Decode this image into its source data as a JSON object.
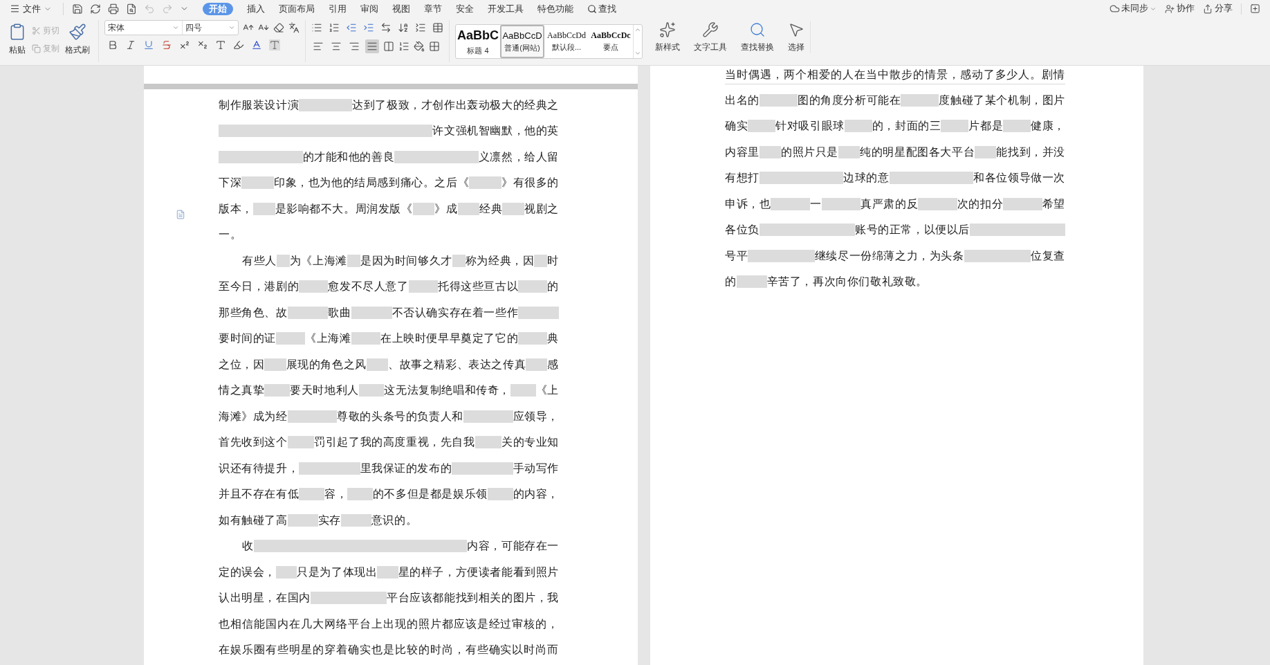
{
  "menu_bar": {
    "file_menu": "文件",
    "tabs": [
      {
        "label": "开始",
        "selected": true
      },
      {
        "label": "插入",
        "selected": false
      },
      {
        "label": "页面布局",
        "selected": false
      },
      {
        "label": "引用",
        "selected": false
      },
      {
        "label": "审阅",
        "selected": false
      },
      {
        "label": "视图",
        "selected": false
      },
      {
        "label": "章节",
        "selected": false
      },
      {
        "label": "安全",
        "selected": false
      },
      {
        "label": "开发工具",
        "selected": false
      },
      {
        "label": "特色功能",
        "selected": false
      }
    ],
    "search": "查找",
    "sync": "未同步",
    "collaborate": "协作",
    "share": "分享"
  },
  "ribbon": {
    "paste": "粘贴",
    "cut": {
      "label": "剪切",
      "disabled": true
    },
    "copy": {
      "label": "复制",
      "disabled": true
    },
    "format_painter": "格式刷",
    "font_family": "宋体",
    "font_size": "四号",
    "align_buttons": [
      {
        "kind": "left",
        "selected": false
      },
      {
        "kind": "center",
        "selected": false
      },
      {
        "kind": "right",
        "selected": false
      },
      {
        "kind": "justify",
        "selected": true
      }
    ],
    "styles": [
      {
        "kind": "heading",
        "preview": "AaBbC",
        "label": "标题 4",
        "selected": false
      },
      {
        "kind": "normal",
        "preview": "AaBbCcD",
        "label": "普通(网站)",
        "selected": true
      },
      {
        "kind": "serif",
        "preview": "AaBbCcDd",
        "label": "默认段...",
        "selected": false
      },
      {
        "kind": "bold_serif",
        "preview": "AaBbCcDc",
        "label": "要点",
        "selected": false
      }
    ],
    "new_style": "新样式",
    "text_tools": "文字工具",
    "find_replace": "查找替换",
    "select": "选择"
  },
  "pages": [
    {
      "lines": [
        {
          "indent": false,
          "last": false,
          "parts": [
            {
              "kind": "text",
              "text": "制作服装设计演"
            },
            {
              "kind": "blur"
            },
            {
              "kind": "text",
              "text": "达到了极致，才创作出轰动极大的经典之"
            }
          ]
        },
        {
          "indent": false,
          "last": false,
          "parts": [
            {
              "kind": "blur"
            },
            {
              "kind": "text",
              "text": "许文强机智幽默，他的英"
            }
          ]
        },
        {
          "indent": false,
          "last": false,
          "parts": [
            {
              "kind": "blur"
            },
            {
              "kind": "text",
              "text": "的才能和他的善良"
            },
            {
              "kind": "blur"
            },
            {
              "kind": "text",
              "text": "义凛然，给人留"
            }
          ]
        },
        {
          "indent": false,
          "last": false,
          "parts": [
            {
              "kind": "text",
              "text": "下深"
            },
            {
              "kind": "blur"
            },
            {
              "kind": "text",
              "text": "印象，也为他的结局感到痛心。之后《"
            },
            {
              "kind": "blur"
            },
            {
              "kind": "text",
              "text": "》有很多的"
            }
          ]
        },
        {
          "indent": false,
          "last": false,
          "parts": [
            {
              "kind": "text",
              "text": "版本，"
            },
            {
              "kind": "blur"
            },
            {
              "kind": "text",
              "text": "是影响都不大。周润发版《"
            },
            {
              "kind": "blur"
            },
            {
              "kind": "text",
              "text": "》成"
            },
            {
              "kind": "blur"
            },
            {
              "kind": "text",
              "text": "经典"
            },
            {
              "kind": "blur"
            },
            {
              "kind": "text",
              "text": "视剧之"
            }
          ]
        },
        {
          "indent": false,
          "last": true,
          "parts": [
            {
              "kind": "text",
              "text": "一。"
            }
          ]
        },
        {
          "indent": true,
          "last": false,
          "parts": [
            {
              "kind": "text",
              "text": "有些人"
            },
            {
              "kind": "blur"
            },
            {
              "kind": "text",
              "text": "为《上海滩"
            },
            {
              "kind": "blur"
            },
            {
              "kind": "text",
              "text": "是因为时间够久才"
            },
            {
              "kind": "blur"
            },
            {
              "kind": "text",
              "text": "称为经典，因"
            },
            {
              "kind": "blur"
            },
            {
              "kind": "text",
              "text": "时"
            }
          ]
        },
        {
          "indent": false,
          "last": false,
          "parts": [
            {
              "kind": "text",
              "text": "至今日，港剧的"
            },
            {
              "kind": "blur"
            },
            {
              "kind": "text",
              "text": "愈发不尽人意了"
            },
            {
              "kind": "blur"
            },
            {
              "kind": "text",
              "text": "托得这些亘古以"
            },
            {
              "kind": "blur"
            },
            {
              "kind": "text",
              "text": "的"
            }
          ]
        },
        {
          "indent": false,
          "last": false,
          "parts": [
            {
              "kind": "text",
              "text": "那些角色、故"
            },
            {
              "kind": "blur"
            },
            {
              "kind": "text",
              "text": "歌曲"
            },
            {
              "kind": "blur"
            },
            {
              "kind": "text",
              "text": "不否认确实存在着一些作"
            },
            {
              "kind": "blur"
            }
          ]
        },
        {
          "indent": false,
          "last": false,
          "parts": [
            {
              "kind": "text",
              "text": "要时间的证"
            },
            {
              "kind": "blur"
            },
            {
              "kind": "text",
              "text": "《上海滩"
            },
            {
              "kind": "blur"
            },
            {
              "kind": "text",
              "text": "在上映时便早早奠定了它的"
            },
            {
              "kind": "blur"
            },
            {
              "kind": "text",
              "text": "典"
            }
          ]
        },
        {
          "indent": false,
          "last": false,
          "parts": [
            {
              "kind": "text",
              "text": "之位，因"
            },
            {
              "kind": "blur"
            },
            {
              "kind": "text",
              "text": "展现的角色之风"
            },
            {
              "kind": "blur"
            },
            {
              "kind": "text",
              "text": "、故事之精彩、表达之传真"
            },
            {
              "kind": "blur"
            },
            {
              "kind": "text",
              "text": "感"
            }
          ]
        },
        {
          "indent": false,
          "last": false,
          "parts": [
            {
              "kind": "text",
              "text": "情之真挚"
            },
            {
              "kind": "blur"
            },
            {
              "kind": "text",
              "text": "要天时地利人"
            },
            {
              "kind": "blur"
            },
            {
              "kind": "text",
              "text": "这无法复制绝唱和传奇，"
            },
            {
              "kind": "blur"
            },
            {
              "kind": "text",
              "text": "《上"
            }
          ]
        },
        {
          "indent": false,
          "last": false,
          "parts": [
            {
              "kind": "text",
              "text": "海滩》成为经"
            },
            {
              "kind": "blur"
            },
            {
              "kind": "text",
              "text": "尊敬的头条号的负责人和"
            },
            {
              "kind": "blur"
            },
            {
              "kind": "text",
              "text": "应领导，"
            }
          ]
        },
        {
          "indent": false,
          "last": false,
          "parts": [
            {
              "kind": "text",
              "text": "首先收到这个"
            },
            {
              "kind": "blur"
            },
            {
              "kind": "text",
              "text": "罚引起了我的高度重视，先自我"
            },
            {
              "kind": "blur"
            },
            {
              "kind": "text",
              "text": "关的专业知"
            }
          ]
        },
        {
          "indent": false,
          "last": false,
          "parts": [
            {
              "kind": "text",
              "text": "识还有待提升，"
            },
            {
              "kind": "blur"
            },
            {
              "kind": "text",
              "text": "里我保证的发布的"
            },
            {
              "kind": "blur"
            },
            {
              "kind": "text",
              "text": "手动写作"
            }
          ]
        },
        {
          "indent": false,
          "last": false,
          "parts": [
            {
              "kind": "text",
              "text": "并且不存在有低"
            },
            {
              "kind": "blur"
            },
            {
              "kind": "text",
              "text": "容，"
            },
            {
              "kind": "blur"
            },
            {
              "kind": "text",
              "text": "的不多但是都是娱乐领"
            },
            {
              "kind": "blur"
            },
            {
              "kind": "text",
              "text": "的内容，"
            }
          ]
        },
        {
          "indent": false,
          "last": true,
          "parts": [
            {
              "kind": "text",
              "text": "如有触碰了高"
            },
            {
              "kind": "blur"
            },
            {
              "kind": "text",
              "text": "实存"
            },
            {
              "kind": "blur"
            },
            {
              "kind": "text",
              "text": "意识的。"
            }
          ]
        },
        {
          "indent": true,
          "last": false,
          "parts": [
            {
              "kind": "text",
              "text": "收"
            },
            {
              "kind": "blur"
            },
            {
              "kind": "text",
              "text": "内容，可能存在一"
            }
          ]
        },
        {
          "indent": false,
          "last": false,
          "parts": [
            {
              "kind": "text",
              "text": "定的误会，"
            },
            {
              "kind": "blur"
            },
            {
              "kind": "text",
              "text": "只是为了体现出"
            },
            {
              "kind": "blur"
            },
            {
              "kind": "text",
              "text": "星的样子，方便读者能看到照片"
            }
          ]
        },
        {
          "indent": false,
          "last": false,
          "parts": [
            {
              "kind": "text",
              "text": "认出明星，在国内"
            },
            {
              "kind": "blur"
            },
            {
              "kind": "text",
              "text": "平台应该都能找到相关的图片，我"
            }
          ]
        },
        {
          "indent": false,
          "last": false,
          "parts": [
            {
              "kind": "text",
              "text": "也相信能国内在几大网络平台上出现的照片都应该是经过审核的，"
            }
          ]
        },
        {
          "indent": false,
          "last": false,
          "parts": [
            {
              "kind": "text",
              "text": "在娱乐圈有些明星的穿着确实也是比较的时尚，有些确实以时尚而"
            }
          ]
        }
      ]
    },
    {
      "top_line": "当时偶遇，两个相爱的人在当中散步的情景，感动了多少人。剧情",
      "lines": [
        {
          "indent": false,
          "last": false,
          "parts": [
            {
              "kind": "text",
              "text": "出名的"
            },
            {
              "kind": "blur"
            },
            {
              "kind": "text",
              "text": "图的角度分析可能在"
            },
            {
              "kind": "blur"
            },
            {
              "kind": "text",
              "text": "度触碰了某个机制，图片"
            }
          ]
        },
        {
          "indent": false,
          "last": false,
          "parts": [
            {
              "kind": "text",
              "text": "确实"
            },
            {
              "kind": "blur"
            },
            {
              "kind": "text",
              "text": "针对吸引眼球"
            },
            {
              "kind": "blur"
            },
            {
              "kind": "text",
              "text": "的，封面的三"
            },
            {
              "kind": "blur"
            },
            {
              "kind": "text",
              "text": "片都是"
            },
            {
              "kind": "blur"
            },
            {
              "kind": "text",
              "text": "健康，"
            }
          ]
        },
        {
          "indent": false,
          "last": false,
          "parts": [
            {
              "kind": "text",
              "text": "内容里"
            },
            {
              "kind": "blur"
            },
            {
              "kind": "text",
              "text": "的照片只是"
            },
            {
              "kind": "blur"
            },
            {
              "kind": "text",
              "text": "纯的明星配图各大平台"
            },
            {
              "kind": "blur"
            },
            {
              "kind": "text",
              "text": "能找到，并没"
            }
          ]
        },
        {
          "indent": false,
          "last": false,
          "parts": [
            {
              "kind": "text",
              "text": "有想打"
            },
            {
              "kind": "blur"
            },
            {
              "kind": "text",
              "text": "边球的意"
            },
            {
              "kind": "blur"
            },
            {
              "kind": "text",
              "text": "和各位领导做一次"
            }
          ]
        },
        {
          "indent": false,
          "last": false,
          "parts": [
            {
              "kind": "text",
              "text": "申诉，也"
            },
            {
              "kind": "blur"
            },
            {
              "kind": "text",
              "text": "一"
            },
            {
              "kind": "blur"
            },
            {
              "kind": "text",
              "text": "真严肃的反"
            },
            {
              "kind": "blur"
            },
            {
              "kind": "text",
              "text": "次的扣分"
            },
            {
              "kind": "blur"
            },
            {
              "kind": "text",
              "text": "希望"
            }
          ]
        },
        {
          "indent": false,
          "last": false,
          "parts": [
            {
              "kind": "text",
              "text": "各位负"
            },
            {
              "kind": "blur"
            },
            {
              "kind": "text",
              "text": "账号的正常，以便以后"
            },
            {
              "kind": "blur"
            }
          ]
        },
        {
          "indent": false,
          "last": false,
          "parts": [
            {
              "kind": "text",
              "text": "号平"
            },
            {
              "kind": "blur"
            },
            {
              "kind": "text",
              "text": "继续尽一份绵薄之力，为头条"
            },
            {
              "kind": "blur"
            },
            {
              "kind": "text",
              "text": "位复查"
            }
          ]
        },
        {
          "indent": false,
          "last": true,
          "parts": [
            {
              "kind": "text",
              "text": "的"
            },
            {
              "kind": "blur"
            },
            {
              "kind": "text",
              "text": "辛苦了，再次向你们敬礼致敬。"
            }
          ]
        }
      ]
    }
  ]
}
